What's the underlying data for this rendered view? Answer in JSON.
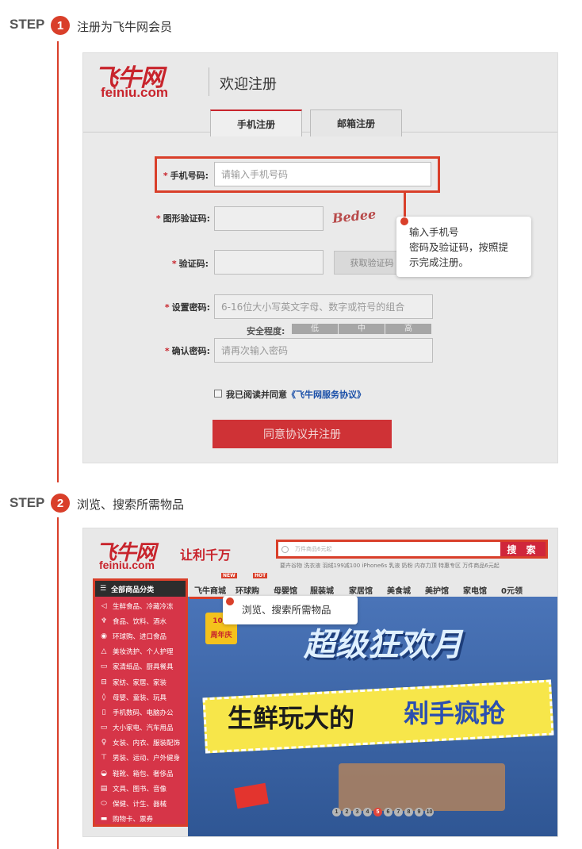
{
  "steps": [
    {
      "word": "STEP",
      "number": "1",
      "title": "注册为飞牛网会员"
    },
    {
      "word": "STEP",
      "number": "2",
      "title": "浏览、搜索所需物品"
    }
  ],
  "register": {
    "logo_main": "飞牛网",
    "logo_sub": "feiniu.com",
    "welcome": "欢迎注册",
    "tabs": [
      {
        "label": "手机注册",
        "active": true
      },
      {
        "label": "邮箱注册",
        "active": false
      }
    ],
    "fields": {
      "phone": {
        "label": "手机号码:",
        "placeholder": "请输入手机号码"
      },
      "captcha_img": {
        "label": "图形验证码:",
        "captcha_text": "Bedee",
        "placeholder": ""
      },
      "sms": {
        "label": "验证码:",
        "button": "获取验证码",
        "placeholder": ""
      },
      "password": {
        "label": "设置密码:",
        "placeholder": "6-16位大小写英文字母、数字或符号的组合"
      },
      "confirm": {
        "label": "确认密码:",
        "placeholder": "请再次输入密码"
      }
    },
    "strength_label": "安全程度:",
    "strength_levels": [
      "低",
      "中",
      "高"
    ],
    "agree_text": "我已阅读并同意",
    "agree_link": "《飞牛网服务协议》",
    "submit": "同意协议并注册",
    "tooltip": [
      "输入手机号",
      "密码及验证码，按照提",
      "示完成注册。"
    ]
  },
  "browse": {
    "logo_main": "飞牛网",
    "logo_sub": "feiniu.com",
    "slogan": "让利千万",
    "search_placeholder": "万件商品6元起",
    "search_button": "搜 索",
    "hot_words": "要卉谷物  洗衣液  羽绒199减100  iPhone6s  乳液  奶粉  内存力顶  特惠专区  万件商品6元起",
    "nav": [
      {
        "label": "飞牛商城",
        "badge": "NEW"
      },
      {
        "label": "环球购",
        "badge": "HOT"
      },
      {
        "label": "母婴馆",
        "badge": ""
      },
      {
        "label": "服装城",
        "badge": ""
      },
      {
        "label": "家居馆",
        "badge": ""
      },
      {
        "label": "美食城",
        "badge": ""
      },
      {
        "label": "美护馆",
        "badge": ""
      },
      {
        "label": "家电馆",
        "badge": ""
      },
      {
        "label": "0元领",
        "badge": ""
      }
    ],
    "category_header": "全部商品分类",
    "categories": [
      {
        "icon": "fish-icon",
        "glyph": "◁",
        "label": "生鲜食品、冷藏冷冻"
      },
      {
        "icon": "cup-icon",
        "glyph": "♆",
        "label": "食品、饮料、酒水"
      },
      {
        "icon": "location-icon",
        "glyph": "◉",
        "label": "环球购、进口食品"
      },
      {
        "icon": "bottle-icon",
        "glyph": "△",
        "label": "美妆洗护、个人护理"
      },
      {
        "icon": "tissue-icon",
        "glyph": "▭",
        "label": "家清纸品、厨具餐具"
      },
      {
        "icon": "sofa-icon",
        "glyph": "⊟",
        "label": "家纺、家居、家装"
      },
      {
        "icon": "baby-bottle-icon",
        "glyph": "◊",
        "label": "母婴、童装、玩具"
      },
      {
        "icon": "phone-icon",
        "glyph": "▯",
        "label": "手机数码、电脑办公"
      },
      {
        "icon": "tv-icon",
        "glyph": "▭",
        "label": "大小家电、汽车用品"
      },
      {
        "icon": "person-icon",
        "glyph": "♀",
        "label": "女装、内衣、服装配饰"
      },
      {
        "icon": "shirt-icon",
        "glyph": "⊤",
        "label": "男装、运动、户外健身"
      },
      {
        "icon": "bag-icon",
        "glyph": "◒",
        "label": "鞋靴、箱包、奢侈品"
      },
      {
        "icon": "book-icon",
        "glyph": "▤",
        "label": "文具、图书、音像"
      },
      {
        "icon": "pill-icon",
        "glyph": "⬭",
        "label": "保健、计生、器械"
      },
      {
        "icon": "card-icon",
        "glyph": "▬",
        "label": "购物卡、票券"
      }
    ],
    "banner": {
      "badge_top": "10月",
      "badge_bottom": "周年庆",
      "headline": "超级狂欢月",
      "slogan_left": "生鲜玩大的",
      "slogan_right": "剁手疯抢"
    },
    "pager": [
      "1",
      "2",
      "3",
      "4",
      "5",
      "6",
      "7",
      "8",
      "9",
      "10"
    ],
    "pager_active": 4,
    "tooltip": "浏览、搜索所需物品"
  }
}
